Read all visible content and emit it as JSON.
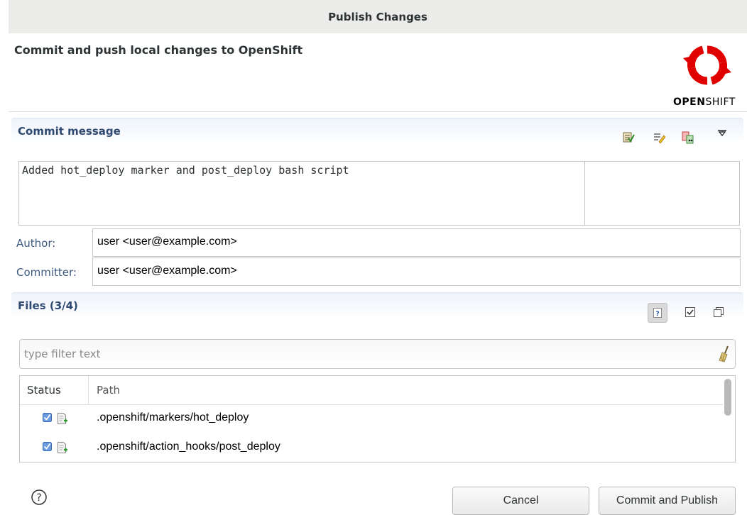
{
  "window": {
    "title": "Publish Changes"
  },
  "header": {
    "description": "Commit and push local changes to OpenShift",
    "logo_text_bold": "OPEN",
    "logo_text_light": "SHIFT",
    "logo_color": "#e00000"
  },
  "commit_section": {
    "title": "Commit message",
    "toolbar": [
      {
        "icon": "spell-check-icon"
      },
      {
        "icon": "signed-off-icon"
      },
      {
        "icon": "compare-icon"
      },
      {
        "icon": "view-menu-icon"
      }
    ],
    "message": "Added hot_deploy marker and post_deploy bash script"
  },
  "author": {
    "label": "Author:",
    "value": "user <user@example.com>"
  },
  "committer": {
    "label": "Committer:",
    "value": "user <user@example.com>"
  },
  "files_section": {
    "title": "Files (3/4)",
    "toolbar": [
      {
        "icon": "show-untracked-icon"
      },
      {
        "icon": "check-all-icon"
      },
      {
        "icon": "uncheck-all-icon"
      }
    ],
    "filter_placeholder": "type filter text",
    "columns": [
      "Status",
      "Path"
    ],
    "rows": [
      {
        "checked": true,
        "path": ".openshift/markers/hot_deploy"
      },
      {
        "checked": true,
        "path": ".openshift/action_hooks/post_deploy"
      }
    ]
  },
  "buttons": {
    "cancel": "Cancel",
    "commit": "Commit and Publish"
  },
  "colors": {
    "section_title": "#2f4a72",
    "field_label": "#3d5a80",
    "check": "#4a7fd4"
  }
}
